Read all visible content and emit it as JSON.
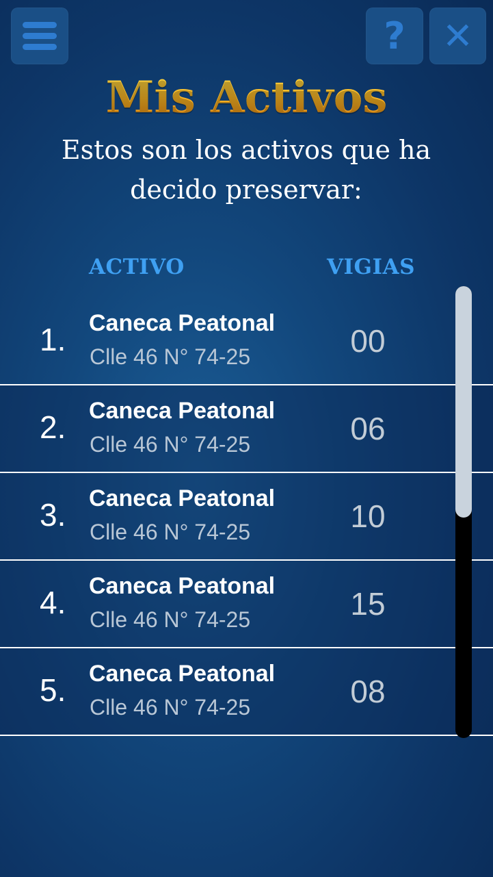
{
  "header": {
    "menu_icon": "hamburger-menu-icon",
    "help_icon": "question-mark-icon",
    "help_glyph": "?",
    "close_icon": "close-x-icon",
    "close_glyph": "✕",
    "title": "Mis Activos",
    "subtitle": "Estos son los activos que ha decido preservar:"
  },
  "columns": {
    "asset": "ACTIVO",
    "watchers": "VIGIAS"
  },
  "assets": [
    {
      "number": "1.",
      "name": "Caneca Peatonal",
      "address": "Clle 46 N° 74-25",
      "vigias": "00"
    },
    {
      "number": "2.",
      "name": "Caneca Peatonal",
      "address": "Clle 46 N° 74-25",
      "vigias": "06"
    },
    {
      "number": "3.",
      "name": "Caneca Peatonal",
      "address": "Clle 46 N° 74-25",
      "vigias": "10"
    },
    {
      "number": "4.",
      "name": "Caneca Peatonal",
      "address": "Clle 46 N° 74-25",
      "vigias": "15"
    },
    {
      "number": "5.",
      "name": "Caneca Peatonal",
      "address": "Clle 46 N° 74-25",
      "vigias": "08"
    }
  ],
  "colors": {
    "accent": "#3fa0f2",
    "title_gold": "#f7b021",
    "button": "#1a4f86",
    "background": "#0d3566"
  }
}
